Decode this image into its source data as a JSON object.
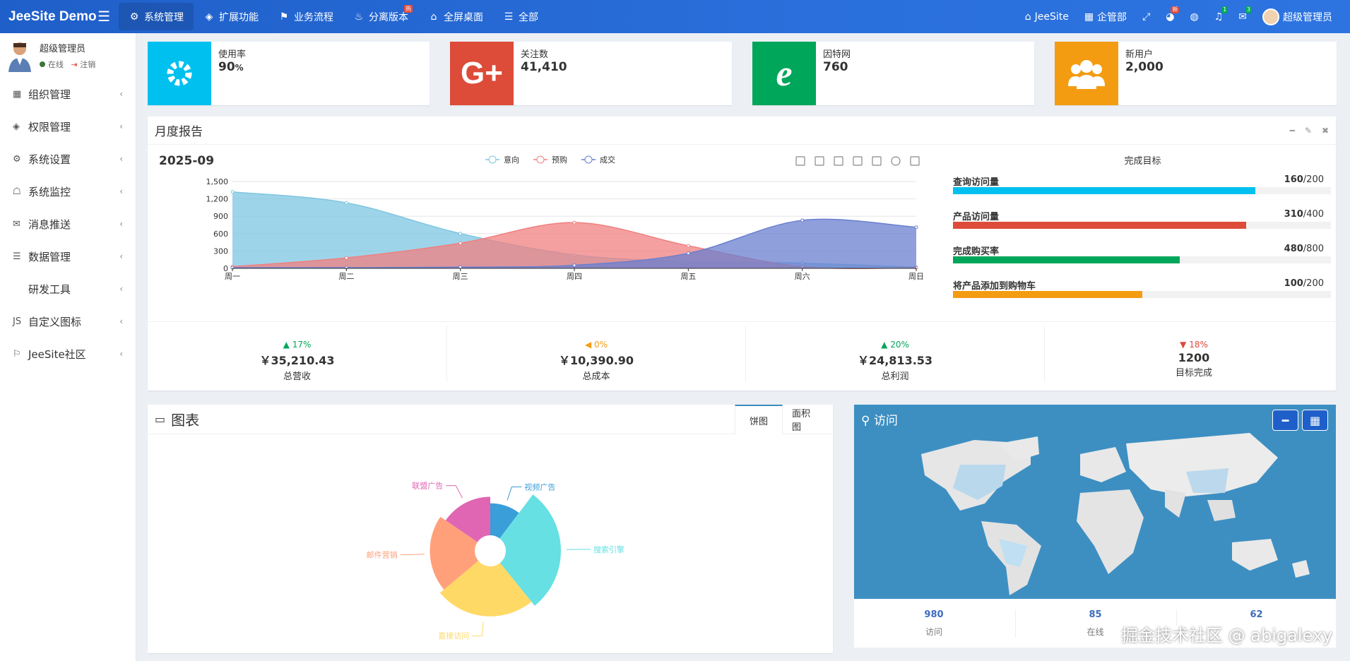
{
  "app": {
    "logo": "JeeSite Demo"
  },
  "topnav": [
    {
      "label": "系统管理",
      "icon": "gear-icon",
      "active": true
    },
    {
      "label": "扩展功能",
      "icon": "layers-icon"
    },
    {
      "label": "业务流程",
      "icon": "flag-icon"
    },
    {
      "label": "分离版本",
      "icon": "fire-icon",
      "badge": "热"
    },
    {
      "label": "全屏桌面",
      "icon": "home-icon"
    },
    {
      "label": "全部",
      "icon": "list-icon"
    }
  ],
  "topright": {
    "jeesite": "JeeSite",
    "enterprise": "企管部",
    "user": "超级管理员",
    "badge_theme": "新",
    "badge_bell": "1",
    "badge_mail": "3"
  },
  "user": {
    "name": "超级管理员",
    "status": "在线",
    "logout": "注销"
  },
  "menu": [
    {
      "label": "组织管理",
      "icon": "grid-icon"
    },
    {
      "label": "权限管理",
      "icon": "dropbox-icon"
    },
    {
      "label": "系统设置",
      "icon": "gear-icon"
    },
    {
      "label": "系统监控",
      "icon": "ghost-icon"
    },
    {
      "label": "消息推送",
      "icon": "envelope-icon"
    },
    {
      "label": "数据管理",
      "icon": "database-icon"
    },
    {
      "label": "研发工具",
      "icon": "code-icon"
    },
    {
      "label": "自定义图标",
      "icon": "js-icon"
    },
    {
      "label": "JeeSite社区",
      "icon": "signpost-icon"
    }
  ],
  "info": [
    {
      "label": "使用率",
      "value": "90",
      "unit": "%",
      "color": "#00c0ef",
      "icon": "gear-icon"
    },
    {
      "label": "关注数",
      "value": "41,410",
      "color": "#dd4b39",
      "icon": "google-plus-icon"
    },
    {
      "label": "因特网",
      "value": "760",
      "color": "#00a65a",
      "icon": "ie-icon"
    },
    {
      "label": "新用户",
      "value": "2,000",
      "color": "#f39c12",
      "icon": "users-icon"
    }
  ],
  "report": {
    "title": "月度报告",
    "month": "2025-09",
    "goals_title": "完成目标"
  },
  "chart_data": {
    "type": "area",
    "categories": [
      "周一",
      "周二",
      "周三",
      "周四",
      "周五",
      "周六",
      "周日"
    ],
    "ylim": [
      0,
      1500
    ],
    "yticks": [
      "0",
      "300",
      "600",
      "900",
      "1,200",
      "1,500"
    ],
    "legend": "top-center",
    "series": [
      {
        "name": "意向",
        "values": [
          1320,
          1132,
          601,
          234,
          120,
          90,
          20
        ],
        "color": "#7ec6e1"
      },
      {
        "name": "预购",
        "values": [
          30,
          182,
          434,
          791,
          390,
          30,
          10
        ],
        "color": "#f08080"
      },
      {
        "name": "成交",
        "values": [
          10,
          12,
          21,
          54,
          260,
          830,
          710
        ],
        "color": "#6a7fcf"
      }
    ]
  },
  "goals": [
    {
      "label": "查询访问量",
      "value": "160",
      "total": "/200",
      "pct": 0.8,
      "color": "#00c0ef"
    },
    {
      "label": "产品访问量",
      "value": "310",
      "total": "/400",
      "pct": 0.775,
      "color": "#dd4b39"
    },
    {
      "label": "完成购买率",
      "value": "480",
      "total": "/800",
      "pct": 0.6,
      "color": "#00a65a"
    },
    {
      "label": "将产品添加到购物车",
      "value": "100",
      "total": "/200",
      "pct": 0.5,
      "color": "#f39c12"
    }
  ],
  "stats": [
    {
      "pct": "17%",
      "dir": "▲",
      "color": "#00a65a",
      "amount": "￥35,210.43",
      "label": "总营收"
    },
    {
      "pct": "0%",
      "dir": "◀",
      "color": "#f39c12",
      "amount": "￥10,390.90",
      "label": "总成本"
    },
    {
      "pct": "20%",
      "dir": "▲",
      "color": "#00a65a",
      "amount": "￥24,813.53",
      "label": "总利润"
    },
    {
      "pct": "18%",
      "dir": "▼",
      "color": "#dd4b39",
      "amount": "1200",
      "label": "目标完成"
    }
  ],
  "charts": {
    "title": "图表",
    "tab_pie": "饼图",
    "tab_area": "面积图"
  },
  "pie_data": {
    "type": "pie",
    "slices": [
      {
        "name": "视频广告",
        "value": 10,
        "color": "#3a9ed9"
      },
      {
        "name": "搜索引擎",
        "value": 28,
        "color": "#66e0e3"
      },
      {
        "name": "直接访问",
        "value": 24,
        "color": "#ffd966"
      },
      {
        "name": "邮件营销",
        "value": 20,
        "color": "#ffa07a"
      },
      {
        "name": "联盟广告",
        "value": 15,
        "color": "#e066b3"
      }
    ]
  },
  "visit": {
    "title": "访问",
    "stats": [
      {
        "n": "980",
        "t": "访问"
      },
      {
        "n": "85",
        "t": "在线"
      },
      {
        "n": "62",
        "t": ""
      }
    ]
  },
  "watermark": "掘金技术社区 @ abigalexy"
}
